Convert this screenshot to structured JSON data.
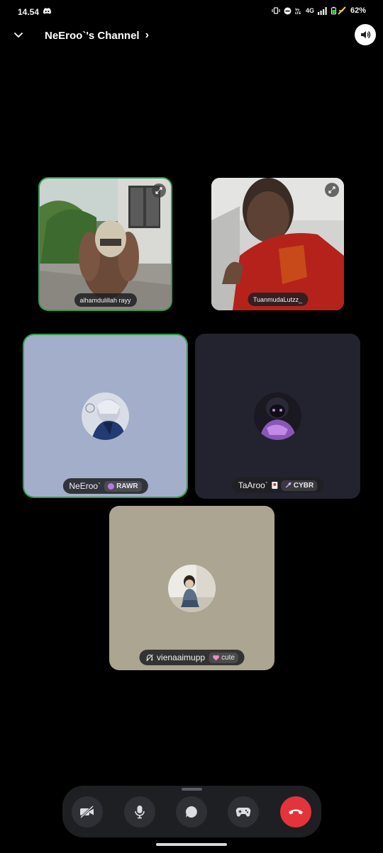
{
  "status_bar": {
    "time": "14.54",
    "network": "4G",
    "battery": "62%",
    "icons": [
      "discord-icon",
      "vibrate-icon",
      "dnd-icon",
      "volte-icon",
      "signal-icon",
      "battery-icon"
    ]
  },
  "header": {
    "channel_name": "NeEroo`'s Channel",
    "chevron": "›"
  },
  "participants": [
    {
      "name": "alhamdulillah rayy",
      "type": "video",
      "speaking": true,
      "icons": [
        "expand-icon"
      ]
    },
    {
      "name": "TuanmudaLutzz_",
      "type": "video",
      "speaking": false,
      "icons": [
        "expand-icon"
      ]
    },
    {
      "name": "NeEroo`",
      "type": "avatar",
      "speaking": true,
      "tag": "RAWR",
      "tile_color": "#a3aecb"
    },
    {
      "name": "TaAroo`",
      "type": "avatar",
      "speaking": false,
      "tag": "CYBR",
      "tile_color": "#23222f"
    },
    {
      "name": "vienaaimupp",
      "type": "avatar",
      "speaking": false,
      "tag": "cute",
      "tile_color": "#aba591",
      "icons": [
        "deafened-icon"
      ]
    }
  ],
  "controls": [
    {
      "name": "camera",
      "icon": "camera-off-icon",
      "state": "off"
    },
    {
      "name": "microphone",
      "icon": "mic-icon",
      "state": "on"
    },
    {
      "name": "chat",
      "icon": "chat-bubble-icon"
    },
    {
      "name": "activities",
      "icon": "gamepad-icon"
    },
    {
      "name": "disconnect",
      "icon": "end-call-icon",
      "color": "#e3343b"
    }
  ],
  "colors": {
    "background": "#000000",
    "speaking_ring": "#2e9e4f",
    "control_bar": "#1e1f22",
    "end_call": "#e3343b"
  }
}
